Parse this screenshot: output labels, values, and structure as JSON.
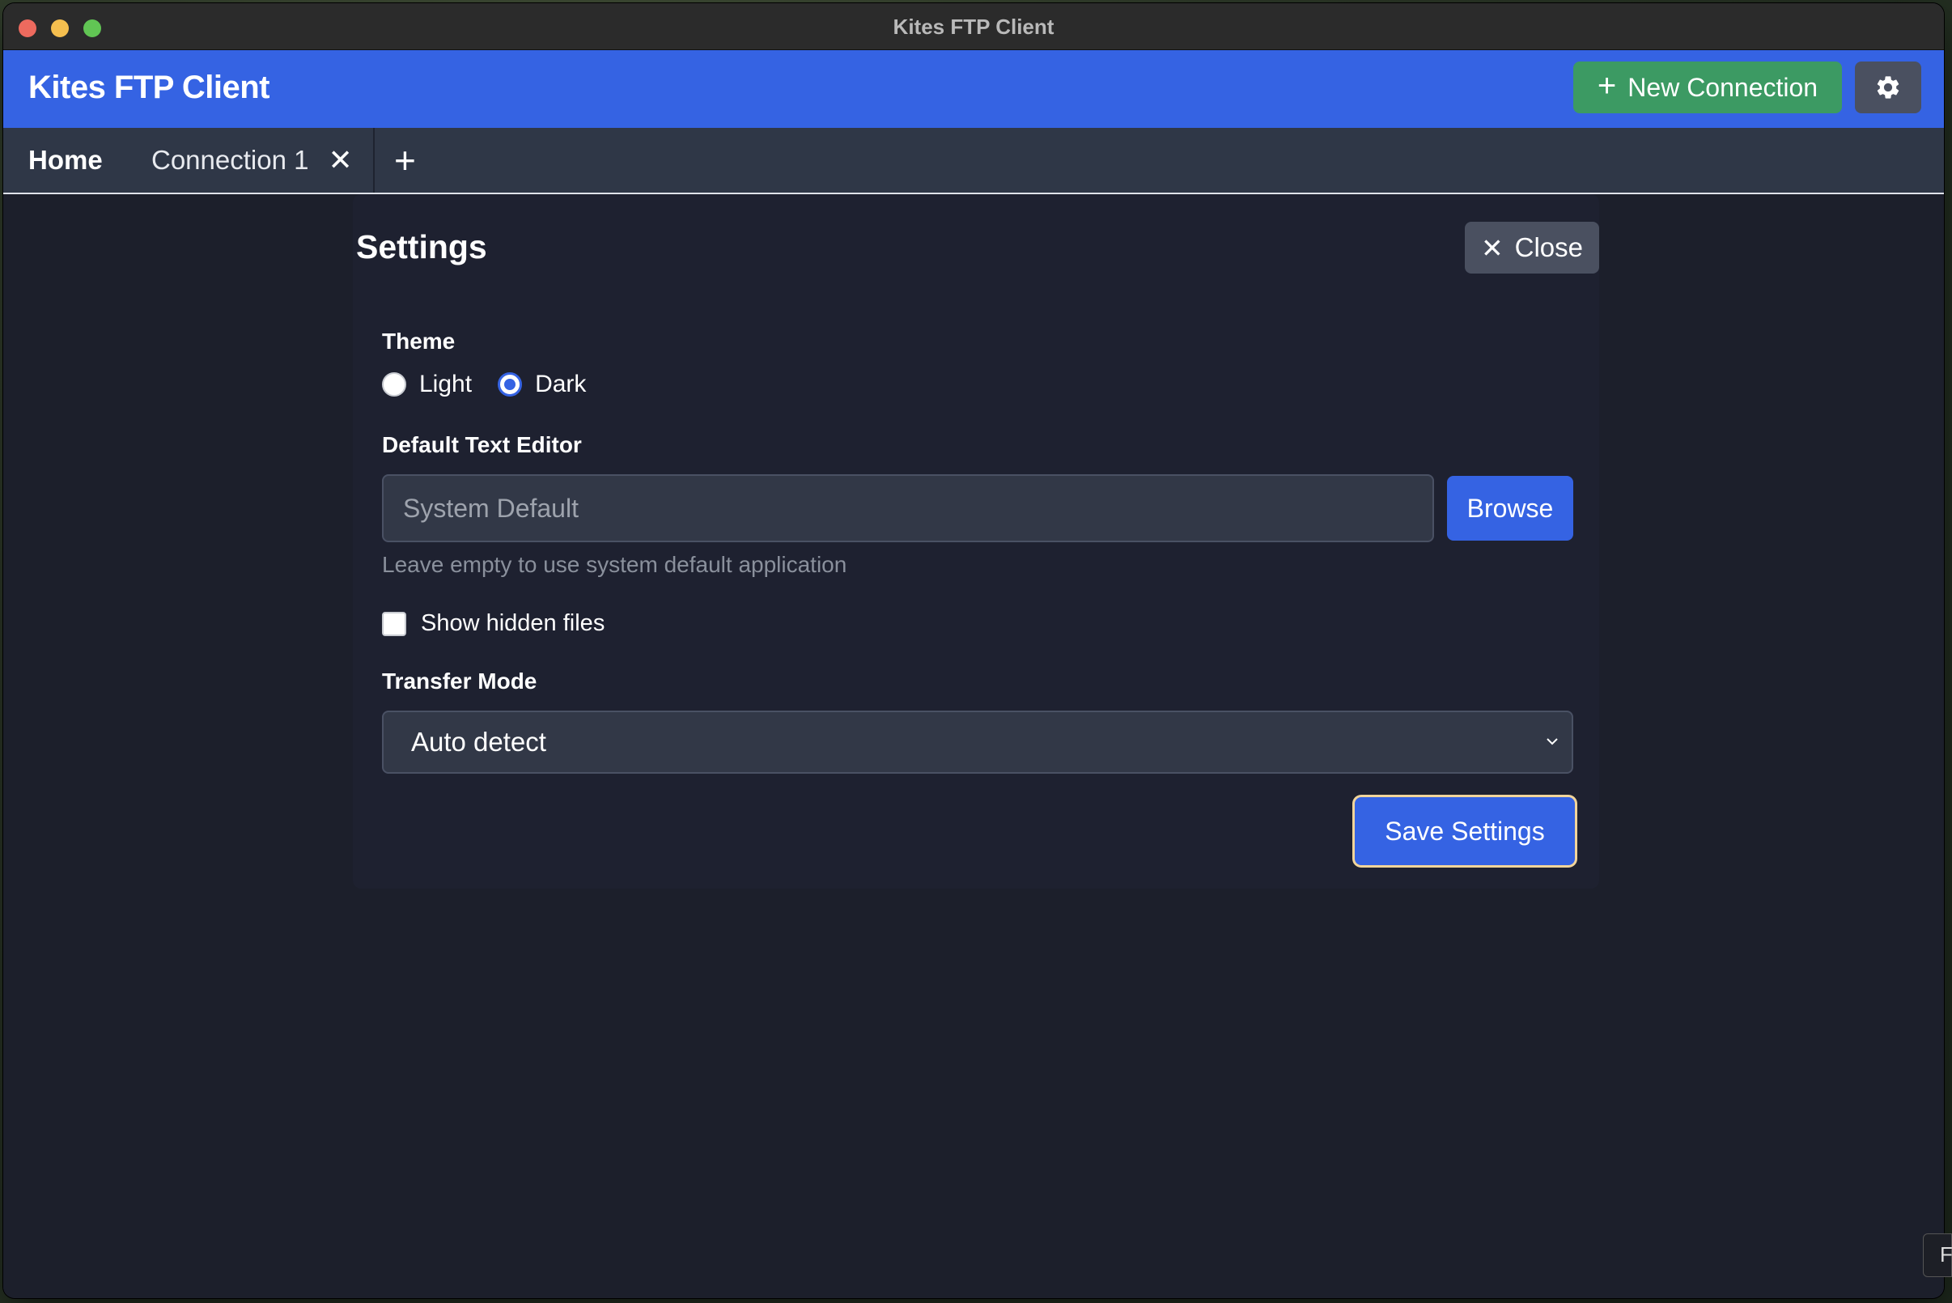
{
  "window": {
    "title": "Kites FTP Client"
  },
  "header": {
    "app_title": "Kites FTP Client",
    "new_connection_label": "New Connection",
    "new_connection_icon": "+"
  },
  "tabs": {
    "home": "Home",
    "connection": "Connection 1",
    "close_icon": "✕",
    "add_icon": "+"
  },
  "settings": {
    "title": "Settings",
    "close_label": "Close",
    "close_icon": "✕",
    "theme": {
      "label": "Theme",
      "options": [
        "Light",
        "Dark"
      ],
      "selected": "Dark"
    },
    "editor": {
      "label": "Default Text Editor",
      "placeholder": "System Default",
      "value": "",
      "browse_label": "Browse",
      "hint": "Leave empty to use system default application"
    },
    "hidden_files": {
      "label": "Show hidden files",
      "checked": false
    },
    "transfer_mode": {
      "label": "Transfer Mode",
      "selected": "Auto detect"
    },
    "save_label": "Save Settings"
  },
  "colors": {
    "accent": "#3563e3",
    "success": "#3c9a63",
    "background": "#1c1f2b"
  },
  "edge_fragment": "F"
}
